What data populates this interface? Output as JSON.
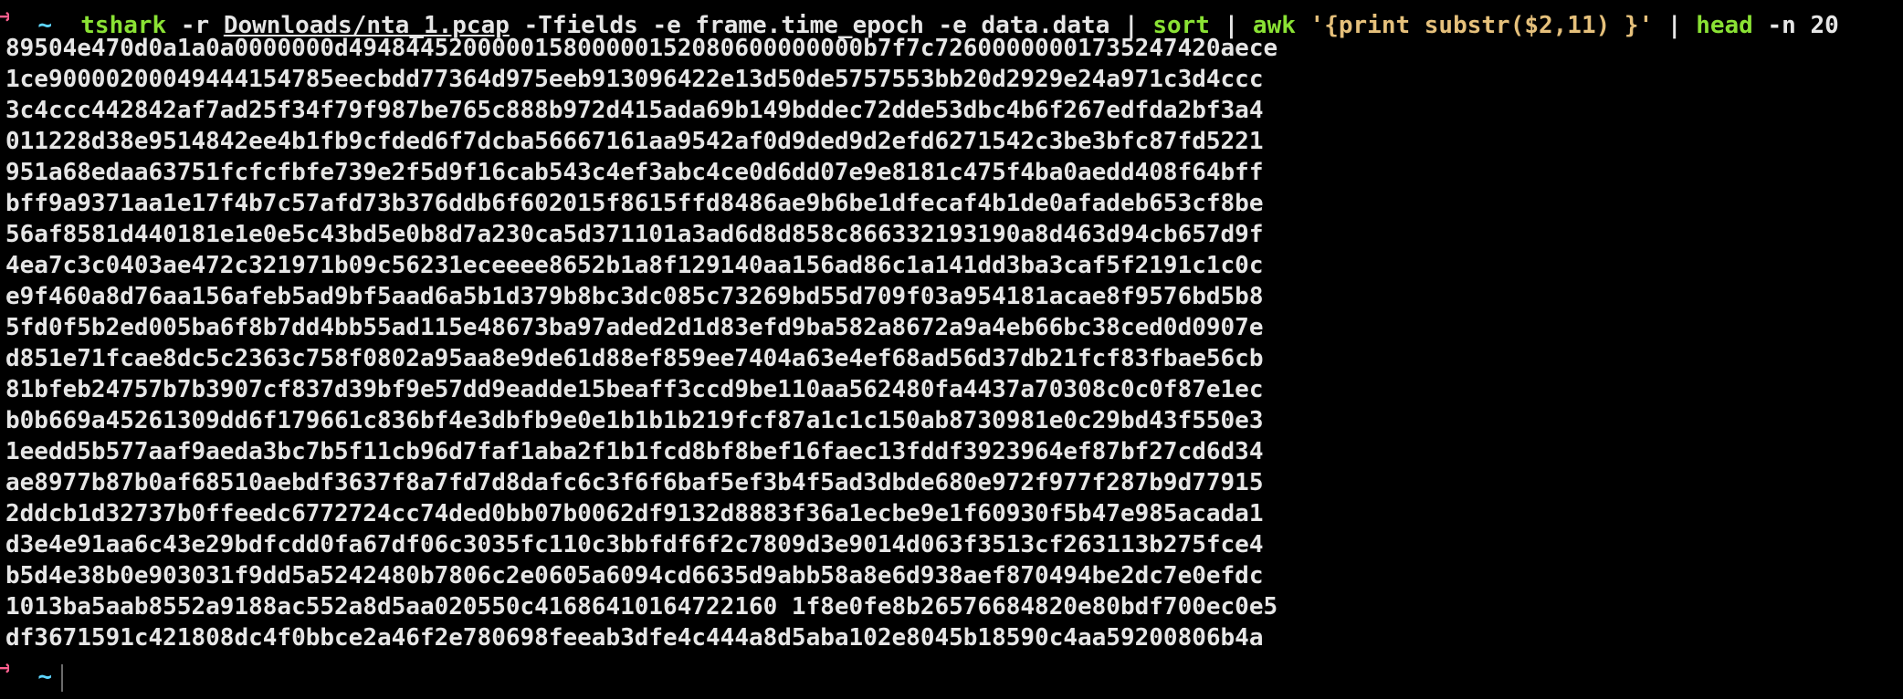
{
  "prompt": {
    "arrow": "➜",
    "cwd": "~"
  },
  "command": {
    "p1_cmd": "tshark",
    "p1_flag": "-r",
    "p1_path": "Downloads/nta_1.pcap",
    "p1_args": "-Tfields -e frame.time_epoch -e data.data",
    "pipe": "|",
    "p2_cmd": "sort",
    "p3_cmd": "awk",
    "p3_script": "'{print substr($2,11) }'",
    "p4_cmd": "head",
    "p4_args": "-n 20"
  },
  "output": [
    "89504e470d0a1a0a0000000d494844520000015800000152080600000000b7f7c72600000001735247420aece",
    "1ce90000200049444154785eecbdd77364d975eeb913096422e13d50de5757553bb20d2929e24a971c3d4ccc",
    "3c4ccc442842af7ad25f34f79f987be765c888b972d415ada69b149bddec72dde53dbc4b6f267edfda2bf3a4",
    "011228d38e9514842ee4b1fb9cfded6f7dcba56667161aa9542af0d9ded9d2efd6271542c3be3bfc87fd5221",
    "951a68edaa63751fcfcfbfe739e2f5d9f16cab543c4ef3abc4ce0d6dd07e9e8181c475f4ba0aedd408f64bff",
    "bff9a9371aa1e17f4b7c57afd73b376ddb6f602015f8615ffd8486ae9b6be1dfecaf4b1de0afadeb653cf8be",
    "56af8581d440181e1e0e5c43bd5e0b8d7a230ca5d371101a3ad6d8d858c866332193190a8d463d94cb657d9f",
    "4ea7c3c0403ae472c321971b09c56231eceeee8652b1a8f129140aa156ad86c1a141dd3ba3caf5f2191c1c0c",
    "e9f460a8d76aa156afeb5ad9bf5aad6a5b1d379b8bc3dc085c73269bd55d709f03a954181acae8f9576bd5b8",
    "5fd0f5b2ed005ba6f8b7dd4bb55ad115e48673ba97aded2d1d83efd9ba582a8672a9a4eb66bc38ced0d0907e",
    "d851e71fcae8dc5c2363c758f0802a95aa8e9de61d88ef859ee7404a63e4ef68ad56d37db21fcf83fbae56cb",
    "81bfeb24757b7b3907cf837d39bf9e57dd9eadde15beaff3ccd9be110aa562480fa4437a70308c0c0f87e1ec",
    "b0b669a45261309dd6f179661c836bf4e3dbfb9e0e1b1b1b219fcf87a1c1c150ab8730981e0c29bd43f550e3",
    "1eedd5b577aaf9aeda3bc7b5f11cb96d7faf1aba2f1b1fcd8bf8bef16faec13fddf3923964ef87bf27cd6d34",
    "ae8977b87b0af68510aebdf3637f8a7fd7d8dafc6c3f6f6baf5ef3b4f5ad3dbde680e972f977f287b9d77915",
    "2ddcb1d32737b0ffeedc6772724cc74ded0bb07b0062df9132d8883f36a1ecbe9e1f60930f5b47e985acada1",
    "d3e4e91aa6c43e29bdfcdd0fa67df06c3035fc110c3bbfdf6f2c7809d3e9014d063f3513cf263113b275fce4",
    "b5d4e38b0e903031f9dd5a5242480b7806c2e0605a6094cd6635d9abb58a8e6d938aef870494be2dc7e0efdc",
    "1013ba5aab8552a9188ac552a8d5aa020550c41686410164722160 1f8e0fe8b26576684820e80bdf700ec0e5",
    "df3671591c421808dc4f0bbce2a46f2e780698feeab3dfe4c444a8d5aba102e8045b18590c4aa59200806b4a"
  ]
}
